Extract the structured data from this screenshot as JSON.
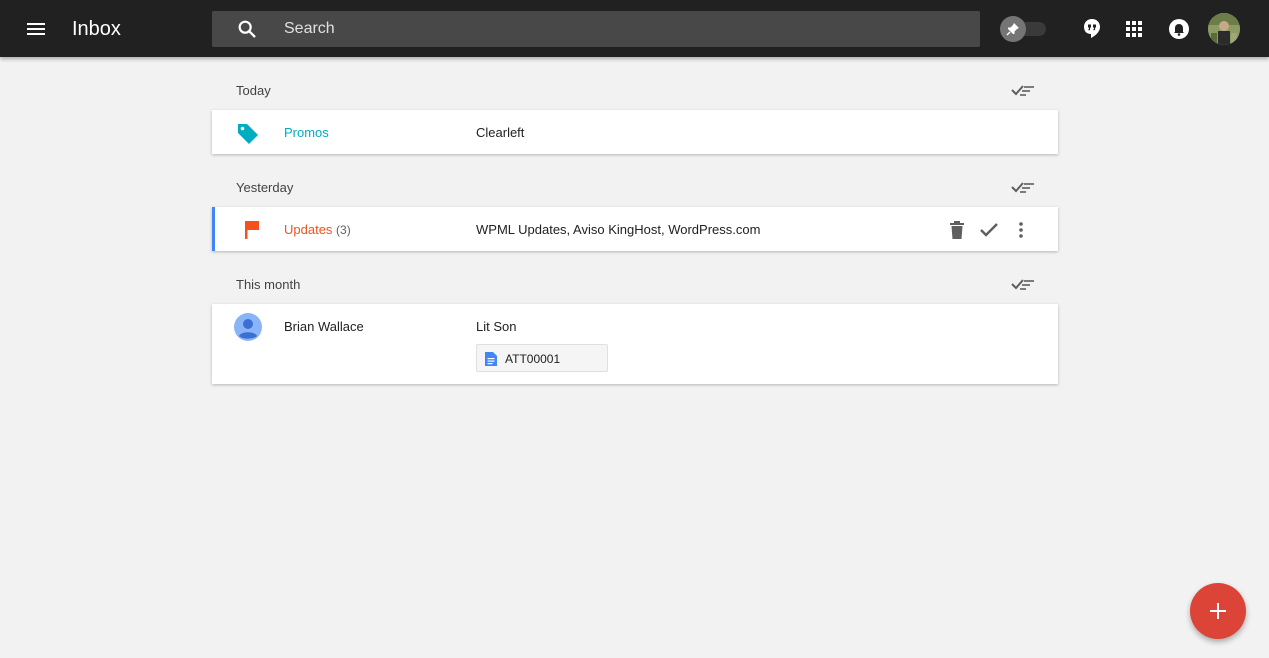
{
  "header": {
    "title": "Inbox",
    "search_placeholder": "Search"
  },
  "colors": {
    "topbar": "#212121",
    "promos": "#00acc1",
    "updates": "#f4511e",
    "fab": "#db4437",
    "selected_bar": "#4285f4"
  },
  "sections": {
    "today": {
      "label": "Today",
      "items": [
        {
          "sender": "Promos",
          "icon": "tag-icon",
          "summary": "Clearleft"
        }
      ]
    },
    "yesterday": {
      "label": "Yesterday",
      "items": [
        {
          "sender": "Updates",
          "count": "(3)",
          "icon": "flag-icon",
          "summary": "WPML Updates, Aviso KingHost, WordPress.com"
        }
      ]
    },
    "this_month": {
      "label": "This month",
      "items": [
        {
          "sender": "Brian Wallace",
          "icon": "person-avatar-icon",
          "summary": "Lit Son",
          "attachment": "ATT00001"
        }
      ]
    }
  }
}
